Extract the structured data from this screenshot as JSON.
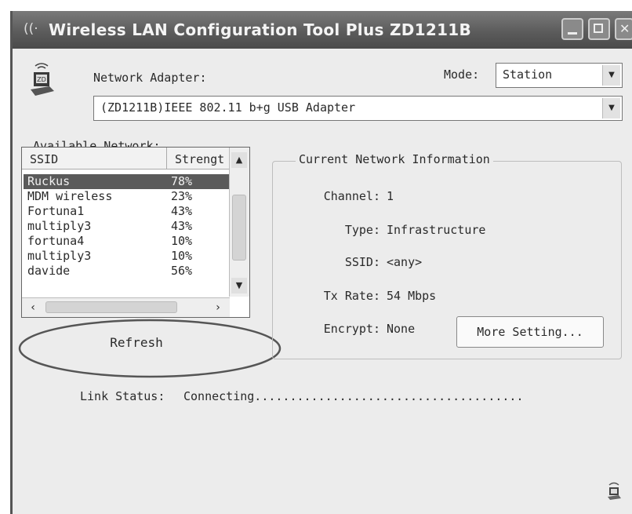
{
  "window": {
    "title": "Wireless LAN Configuration Tool Plus  ZD1211B",
    "title_icon": "wifi-signal-icon"
  },
  "adapter": {
    "label": "Network Adapter:",
    "selected": "(ZD1211B)IEEE 802.11 b+g USB Adapter",
    "icon": "usb-adapter-icon"
  },
  "mode": {
    "label": "Mode:",
    "selected": "Station"
  },
  "networks": {
    "label": "Available Network:",
    "columns": [
      "SSID",
      "Strengt"
    ],
    "rows": [
      {
        "ssid": "Ruckus",
        "strength": "78%",
        "selected": true
      },
      {
        "ssid": "MDM wireless",
        "strength": "23%"
      },
      {
        "ssid": "Fortuna1",
        "strength": "43%"
      },
      {
        "ssid": "multiply3",
        "strength": "43%"
      },
      {
        "ssid": "fortuna4",
        "strength": "10%"
      },
      {
        "ssid": "multiply3",
        "strength": "10%"
      },
      {
        "ssid": "davide",
        "strength": "56%"
      }
    ]
  },
  "refresh_label": "Refresh",
  "current_info": {
    "title": "Current Network Information",
    "channel_label": "Channel:",
    "channel": "1",
    "type_label": "Type:",
    "type": "Infrastructure",
    "ssid_label": "SSID:",
    "ssid": "<any>",
    "txrate_label": "Tx Rate:",
    "txrate": "54 Mbps",
    "encrypt_label": "Encrypt:",
    "encrypt": "None",
    "more_label": "More Setting..."
  },
  "link": {
    "label": "Link Status:",
    "value": "Connecting......................................"
  },
  "colors": {
    "titlebar": "#5c5c5c",
    "selection": "#5a5a5a",
    "window_bg": "#ececec"
  }
}
